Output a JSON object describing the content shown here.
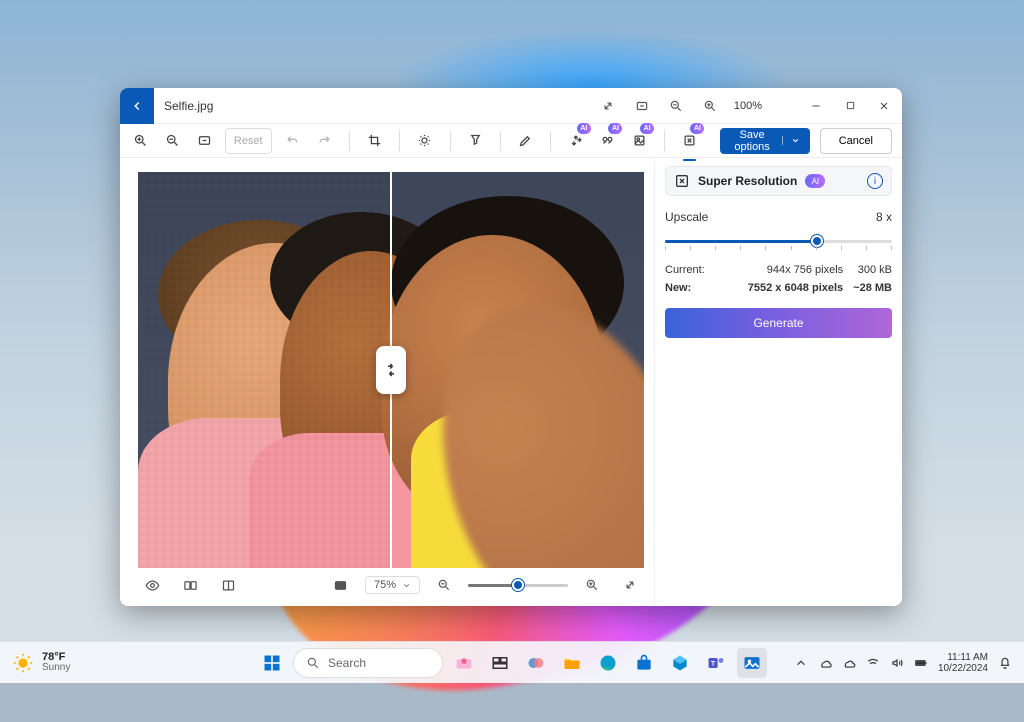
{
  "titlebar": {
    "filename": "Selfie.jpg",
    "zoom_pct": "100%"
  },
  "toolbar": {
    "reset": "Reset",
    "ai_badge": "AI",
    "save_options": "Save options",
    "cancel": "Cancel"
  },
  "panel": {
    "title": "Super Resolution",
    "ai_pill": "AI",
    "upscale_label": "Upscale",
    "upscale_value": "8 x",
    "current_label": "Current:",
    "current_dims": "944x 756 pixels",
    "current_size": "300 kB",
    "new_label": "New:",
    "new_dims": "7552 x 6048 pixels",
    "new_size": "~28 MB",
    "generate": "Generate"
  },
  "bottombar": {
    "zoom_value": "75%"
  },
  "taskbar": {
    "search": "Search",
    "temp": "78°F",
    "condition": "Sunny",
    "time": "11:11 AM",
    "date": "10/22/2024"
  }
}
